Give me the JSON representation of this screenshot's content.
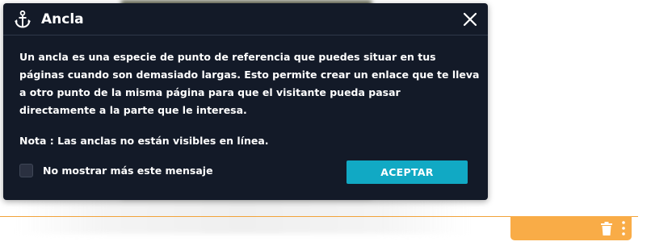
{
  "modal": {
    "title": "Ancla",
    "icons": {
      "title_icon": "anchor-icon",
      "close": "close-icon"
    },
    "body_paragraphs": [
      "Un ancla es una especie de punto de referencia que puedes situar en tus páginas cuando son demasiado largas. Esto permite crear un enlace que te lleva a otro punto de la misma página para que el visitante pueda pasar directamente a la parte que le interesa."
    ],
    "note": "Nota : Las anclas no están visibles en línea.",
    "checkbox": {
      "label": "No mostrar más este mensaje",
      "checked": false
    },
    "accept_label": "ACEPTAR"
  },
  "section_toolbar": {
    "icons": [
      "trash-icon",
      "kebab-menu-icon"
    ]
  },
  "colors": {
    "modal_background": "#131a28",
    "accent_button": "#11a9c4",
    "section_highlight": "#f9ac47",
    "text": "#ffffff"
  }
}
